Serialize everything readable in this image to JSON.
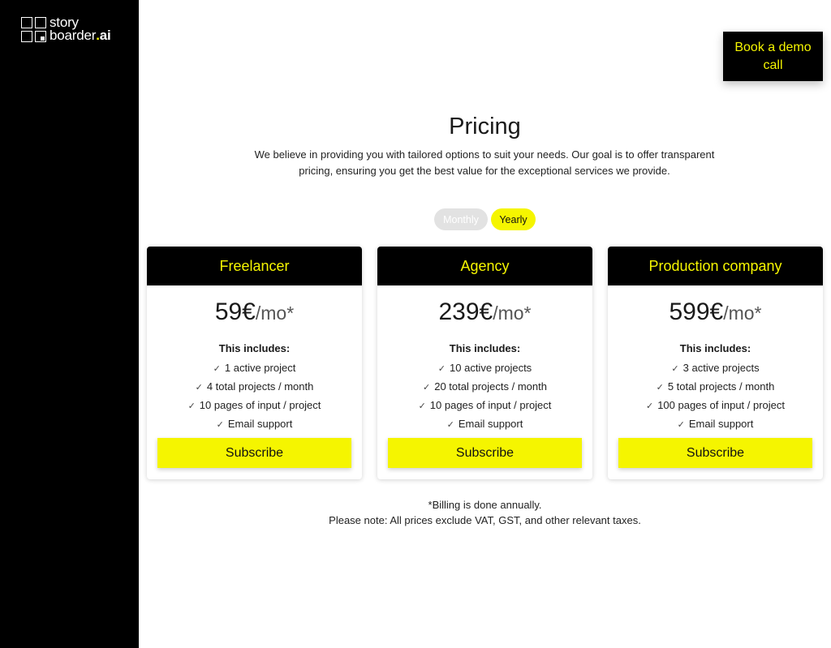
{
  "brand": {
    "line1": "story",
    "line2_prefix": "boarder",
    "line2_dot": ".",
    "line2_suffix": "ai"
  },
  "header": {
    "demo_button": "Book a demo call"
  },
  "pricing": {
    "title": "Pricing",
    "subtitle": "We believe in providing you with tailored options to suit your needs. Our goal is to offer transparent pricing, ensuring you get the best value for the exceptional services we provide.",
    "toggle": {
      "monthly": "Monthly",
      "yearly": "Yearly",
      "selected": "Yearly"
    }
  },
  "plans": [
    {
      "name": "Freelancer",
      "price": "59€",
      "period": "/mo*",
      "includes_label": "This includes:",
      "features": [
        "1 active project",
        "4 total projects / month",
        "10 pages of input / project",
        "Email support"
      ],
      "cta": "Subscribe"
    },
    {
      "name": "Agency",
      "price": "239€",
      "period": "/mo*",
      "includes_label": "This includes:",
      "features": [
        "10 active projects",
        "20 total projects / month",
        "10 pages of input / project",
        "Email support"
      ],
      "cta": "Subscribe"
    },
    {
      "name": "Production company",
      "price": "599€",
      "period": "/mo*",
      "includes_label": "This includes:",
      "features": [
        "3 active projects",
        "5 total projects / month",
        "100 pages of input / project",
        "Email support"
      ],
      "cta": "Subscribe"
    }
  ],
  "footer_note": {
    "line1": "*Billing is done annually.",
    "line2": "Please note: All prices exclude VAT, GST, and other relevant taxes."
  },
  "icons": {
    "check": "checkmark-icon",
    "logo": "storyboarder-logo-icon"
  },
  "colors": {
    "accent": "#f5f500",
    "dark": "#000000",
    "toggle_inactive": "#e2e2e2"
  }
}
